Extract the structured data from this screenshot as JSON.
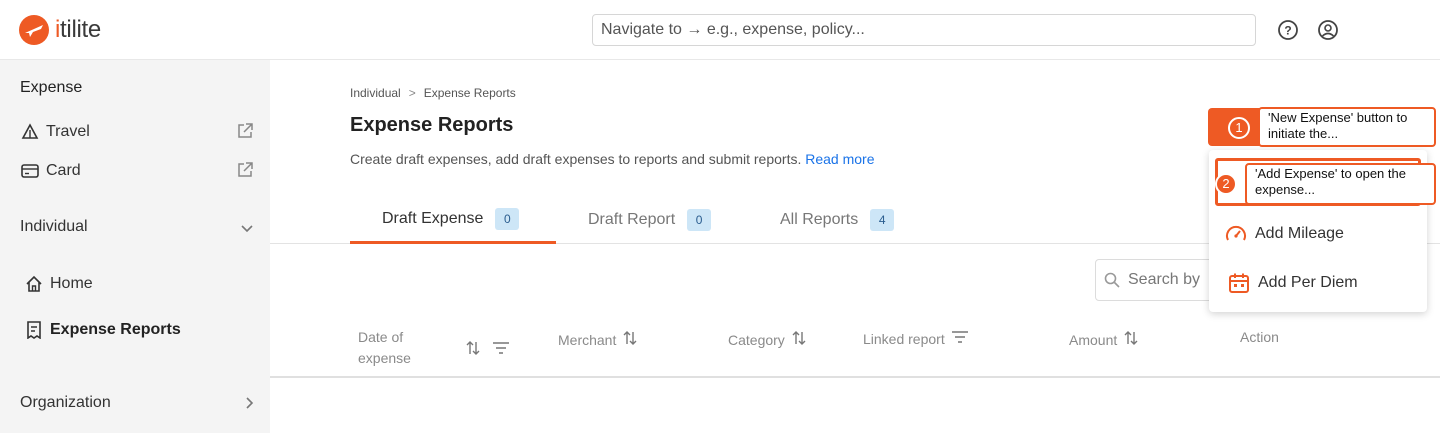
{
  "brand": {
    "name_prefix": "i",
    "name_rest": "tilite",
    "color": "#ee5a24"
  },
  "topbar": {
    "search_placeholder": "Navigate to → e.g., expense, policy..."
  },
  "sidebar": {
    "section_expense": "Expense",
    "travel": "Travel",
    "card": "Card",
    "section_individual": "Individual",
    "home": "Home",
    "expense_reports": "Expense Reports",
    "section_organization": "Organization"
  },
  "main": {
    "breadcrumb": [
      "Individual",
      ">",
      "Expense Reports"
    ],
    "title": "Expense Reports",
    "description": "Create draft expenses, add draft expenses to reports and submit reports.",
    "read_more": "Read more",
    "tabs": [
      {
        "label": "Draft Expense",
        "count": "0"
      },
      {
        "label": "Draft Report",
        "count": "0"
      },
      {
        "label": "All Reports",
        "count": "4"
      }
    ],
    "search_placeholder": "Search by",
    "columns": {
      "date_line1": "Date of",
      "date_line2": "expense",
      "merchant": "Merchant",
      "category": "Category",
      "linked_report": "Linked report",
      "amount": "Amount",
      "action": "Action"
    }
  },
  "dropdown": {
    "add_mileage": "Add Mileage",
    "add_per_diem": "Add Per Diem"
  },
  "annotations": [
    {
      "num": "1",
      "text_line1": "'New Expense' button to",
      "text_line2": "initiate the..."
    },
    {
      "num": "2",
      "text_line1": "'Add Expense' to open the",
      "text_line2": "expense..."
    }
  ]
}
